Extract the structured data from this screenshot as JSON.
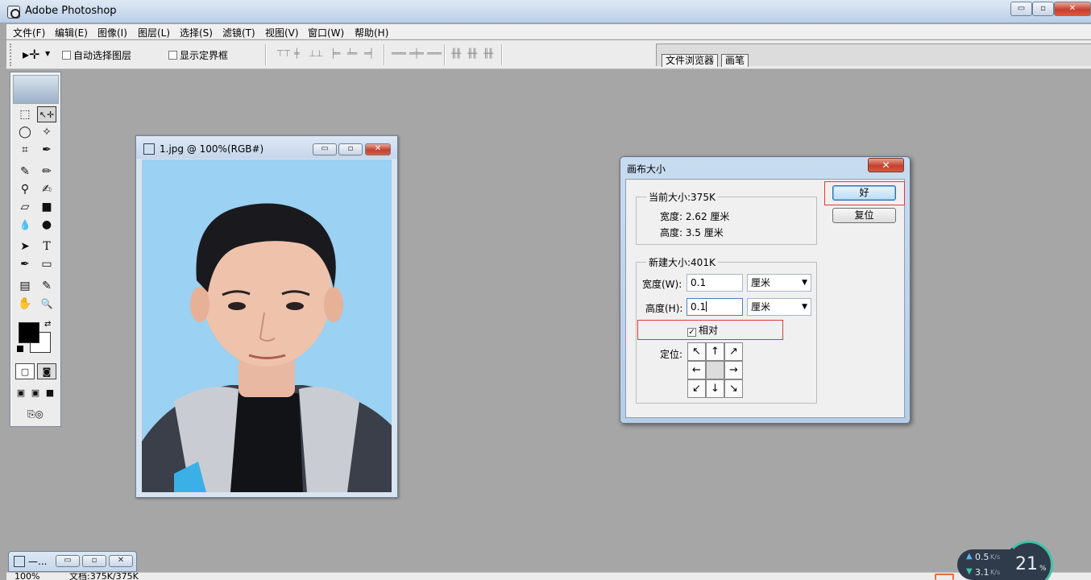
{
  "app": {
    "title": "Adobe Photoshop",
    "window_buttons": [
      "▭",
      "▫",
      "✕"
    ]
  },
  "menu": {
    "items": [
      "文件(F)",
      "编辑(E)",
      "图像(I)",
      "图层(L)",
      "选择(S)",
      "滤镜(T)",
      "视图(V)",
      "窗口(W)",
      "帮助(H)"
    ]
  },
  "options": {
    "auto_select_label": "自动选择图层",
    "show_bounds_label": "显示定界框",
    "auto_select_checked": false,
    "show_bounds_checked": false
  },
  "palette_well": {
    "tabs": [
      "文件浏览器",
      "画笔"
    ]
  },
  "toolbox": {
    "tools": [
      "⬚",
      "↖✛",
      "◯",
      "✧",
      "⌗",
      "✒",
      "✎",
      "✏",
      "⚲",
      "✍",
      "▱",
      "■",
      "💧",
      "●",
      "➤",
      "T",
      "✒",
      "▭",
      "▤",
      "✎",
      "✋",
      "🔍"
    ],
    "foreground_color": "#000000",
    "background_color": "#ffffff"
  },
  "document": {
    "title": "1.jpg @ 100%(RGB#)"
  },
  "dialog": {
    "title": "画布大小",
    "close_label": "✕",
    "current": {
      "legend": "当前大小:375K",
      "width_line": "宽度: 2.62 厘米",
      "height_line": "高度: 3.5 厘米"
    },
    "new": {
      "legend": "新建大小:401K",
      "width_label": "宽度(W):",
      "width_value": "0.1",
      "width_unit": "厘米",
      "height_label": "高度(H):",
      "height_value": "0.1",
      "height_unit": "厘米",
      "relative_label": "相对",
      "relative_checked": true,
      "anchor_label": "定位:",
      "anchors": [
        "↖",
        "↑",
        "↗",
        "←",
        "",
        "→",
        "↙",
        "↓",
        "↘"
      ]
    },
    "ok_label": "好",
    "reset_label": "复位"
  },
  "minimized_window": {
    "label": "—..."
  },
  "status_bar": {
    "zoom": "100%",
    "doc_info": "文档:375K/375K"
  },
  "net_monitor": {
    "up": "0.5",
    "down": "3.1",
    "unit": "K/s",
    "percent": "21",
    "percent_unit": "%"
  },
  "colors": {
    "accent_red": "#e0393c",
    "title_blue": "#c9d9ec",
    "canvas_gray": "#a6a6a6"
  }
}
